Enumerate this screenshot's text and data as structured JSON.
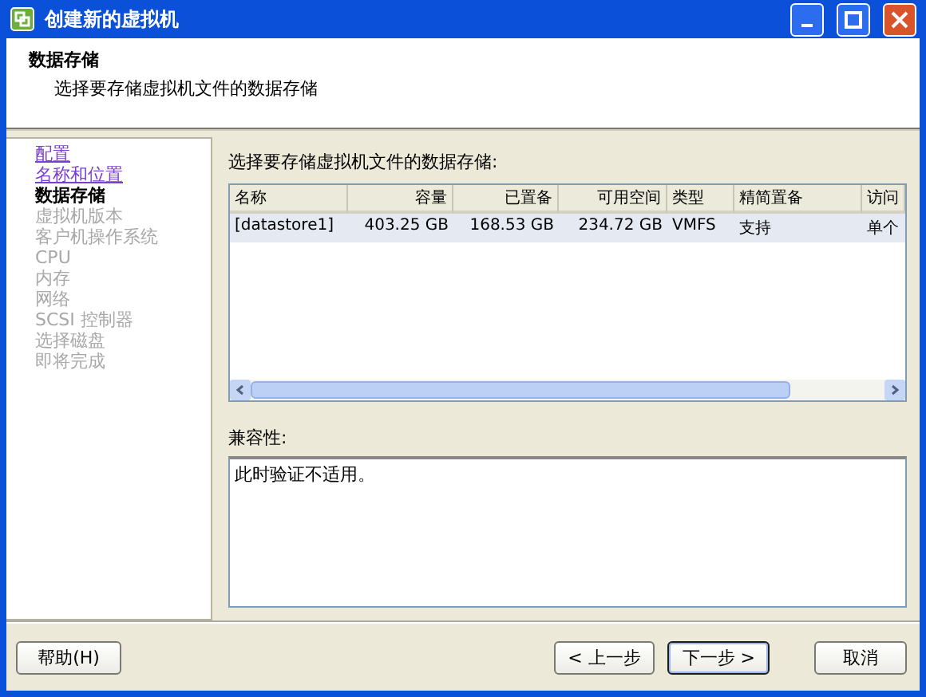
{
  "window": {
    "title": "创建新的虚拟机"
  },
  "header": {
    "title": "数据存储",
    "subtitle": "选择要存储虚拟机文件的数据存储"
  },
  "steps": [
    {
      "label": "配置",
      "visited": true,
      "current": false,
      "disabled": false
    },
    {
      "label": "名称和位置",
      "visited": true,
      "current": false,
      "disabled": false
    },
    {
      "label": "数据存储",
      "visited": false,
      "current": true,
      "disabled": false
    },
    {
      "label": "虚拟机版本",
      "visited": false,
      "current": false,
      "disabled": true
    },
    {
      "label": "客户机操作系统",
      "visited": false,
      "current": false,
      "disabled": true
    },
    {
      "label": "CPU",
      "visited": false,
      "current": false,
      "disabled": true
    },
    {
      "label": "内存",
      "visited": false,
      "current": false,
      "disabled": true
    },
    {
      "label": "网络",
      "visited": false,
      "current": false,
      "disabled": true
    },
    {
      "label": "SCSI 控制器",
      "visited": false,
      "current": false,
      "disabled": true
    },
    {
      "label": "选择磁盘",
      "visited": false,
      "current": false,
      "disabled": true
    },
    {
      "label": "即将完成",
      "visited": false,
      "current": false,
      "disabled": true
    }
  ],
  "table": {
    "label": "选择要存储虚拟机文件的数据存储:",
    "columns": [
      {
        "label": "名称",
        "numeric": false
      },
      {
        "label": "容量",
        "numeric": true
      },
      {
        "label": "已置备",
        "numeric": true
      },
      {
        "label": "可用空间",
        "numeric": true
      },
      {
        "label": "类型",
        "numeric": false
      },
      {
        "label": "精简置备",
        "numeric": false
      },
      {
        "label": "访问",
        "numeric": false
      }
    ],
    "rows": [
      {
        "selected": true,
        "cells": [
          "[datastore1]",
          "403.25 GB",
          "168.53 GB",
          "234.72 GB",
          "VMFS",
          "支持",
          "单个"
        ]
      }
    ]
  },
  "compatibility": {
    "label": "兼容性:",
    "text": "此时验证不适用。"
  },
  "buttons": [
    {
      "label": "帮助(H)",
      "default": false
    },
    {
      "label": "< 上一步",
      "default": false
    },
    {
      "label": "下一步 >",
      "default": true
    },
    {
      "label": "取消",
      "default": false
    }
  ]
}
